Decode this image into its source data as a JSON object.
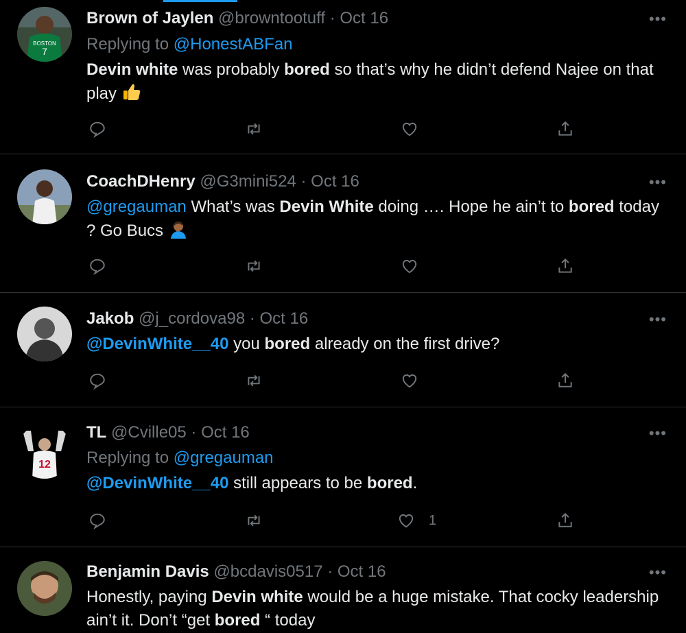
{
  "tweets": [
    {
      "name": "Brown of Jaylen",
      "handle": "@browntootuff",
      "date": "Oct 16",
      "replying_prefix": "Replying to",
      "replying_to": "@HonestABFan",
      "body": [
        {
          "t": "b",
          "text": "Devin white"
        },
        {
          "t": "n",
          "text": " was probably "
        },
        {
          "t": "b",
          "text": "bored"
        },
        {
          "t": "n",
          "text": " so that’s why he didn’t defend Najee on that play "
        }
      ],
      "emoji": "thumbs-up-icon",
      "likes": ""
    },
    {
      "name": "CoachDHenry",
      "handle": "@G3mini524",
      "date": "Oct 16",
      "body": [
        {
          "t": "m",
          "text": "@gregauman"
        },
        {
          "t": "n",
          "text": " What’s was "
        },
        {
          "t": "b",
          "text": "Devin White"
        },
        {
          "t": "n",
          "text": " doing …. Hope he ain’t to "
        },
        {
          "t": "b",
          "text": "bored"
        },
        {
          "t": "n",
          "text": " today ? Go Bucs "
        }
      ],
      "emoji": "facepalm-icon",
      "likes": ""
    },
    {
      "name": "Jakob",
      "handle": "@j_cordova98",
      "date": "Oct 16",
      "body": [
        {
          "t": "m",
          "text": "@DevinWhite__40"
        },
        {
          "t": "n",
          "text": " you "
        },
        {
          "t": "b",
          "text": "bored"
        },
        {
          "t": "n",
          "text": " already on the first drive?"
        }
      ],
      "likes": ""
    },
    {
      "name": "TL",
      "handle": "@Cville05",
      "date": "Oct 16",
      "replying_prefix": "Replying to",
      "replying_to": "@gregauman",
      "body": [
        {
          "t": "m",
          "text": "@DevinWhite__40"
        },
        {
          "t": "n",
          "text": " still appears to be "
        },
        {
          "t": "b",
          "text": "bored"
        },
        {
          "t": "n",
          "text": "."
        }
      ],
      "likes": "1"
    },
    {
      "name": "Benjamin Davis",
      "handle": "@bcdavis0517",
      "date": "Oct 16",
      "body": [
        {
          "t": "n",
          "text": "Honestly, paying "
        },
        {
          "t": "b",
          "text": "Devin white"
        },
        {
          "t": "n",
          "text": " would be a huge mistake. That cocky leadership ain’t it. Don’t “get "
        },
        {
          "t": "b",
          "text": "bored"
        },
        {
          "t": "n",
          "text": " “ today"
        }
      ],
      "likes": ""
    }
  ],
  "separator": " · ",
  "more_label": "•••",
  "colors": {
    "accent": "#1d9bf0",
    "muted": "#71767b",
    "text": "#e7e9ea",
    "background": "#000000"
  }
}
